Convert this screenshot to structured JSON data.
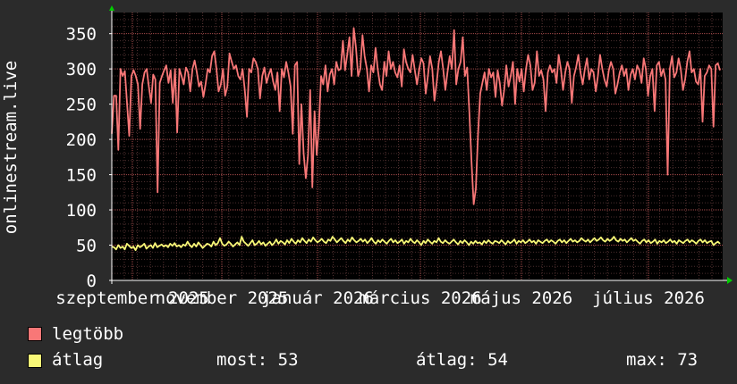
{
  "chart_data": {
    "type": "line",
    "ylabel": "onlinestream.live",
    "ylim": [
      0,
      380
    ],
    "yticks": [
      0,
      50,
      100,
      150,
      200,
      250,
      300,
      350
    ],
    "xtick_labels": [
      "szeptember 2025",
      "november 2025",
      "január 2026",
      "március 2026",
      "május 2026",
      "július 2026"
    ],
    "grid": true,
    "colors": {
      "max": "#f87777",
      "avg": "#f8f877",
      "grid": "#a34a4a",
      "axis": "#ffffff",
      "arrow": "#00cc00"
    },
    "series": [
      {
        "name": "legtöbb",
        "color": "#f87777",
        "values": [
          208,
          262,
          262,
          185,
          300,
          290,
          297,
          250,
          205,
          290,
          298,
          290,
          278,
          215,
          278,
          295,
          300,
          275,
          252,
          292,
          285,
          125,
          280,
          290,
          298,
          305,
          280,
          298,
          252,
          300,
          210,
          300,
          290,
          278,
          302,
          295,
          268,
          300,
          312,
          295,
          275,
          282,
          260,
          278,
          300,
          295,
          318,
          325,
          300,
          268,
          278,
          300,
          262,
          275,
          322,
          310,
          300,
          305,
          290,
          285,
          300,
          270,
          232,
          300,
          295,
          315,
          310,
          300,
          258,
          290,
          302,
          280,
          292,
          300,
          282,
          270,
          295,
          240,
          300,
          288,
          310,
          295,
          275,
          208,
          305,
          310,
          165,
          250,
          180,
          145,
          178,
          270,
          132,
          240,
          178,
          218,
          290,
          278,
          305,
          268,
          292,
          300,
          278,
          310,
          298,
          300,
          340,
          298,
          320,
          345,
          290,
          358,
          330,
          290,
          300,
          348,
          318,
          300,
          268,
          305,
          295,
          330,
          300,
          278,
          270,
          310,
          290,
          325,
          300,
          310,
          295,
          288,
          305,
          275,
          328,
          310,
          300,
          295,
          320,
          298,
          278,
          300,
          315,
          308,
          265,
          290,
          318,
          300,
          255,
          280,
          310,
          325,
          300,
          270,
          295,
          318,
          300,
          355,
          278,
          300,
          310,
          345,
          290,
          302,
          240,
          168,
          108,
          130,
          208,
          265,
          280,
          295,
          270,
          300,
          288,
          295,
          260,
          298,
          280,
          248,
          270,
          305,
          275,
          290,
          310,
          250,
          300,
          282,
          300,
          268,
          300,
          320,
          305,
          270,
          280,
          325,
          290,
          298,
          285,
          240,
          295,
          305,
          295,
          300,
          280,
          320,
          300,
          270,
          295,
          310,
          300,
          252,
          290,
          302,
          320,
          295,
          278,
          300,
          315,
          285,
          300,
          295,
          268,
          290,
          320,
          300,
          285,
          275,
          298,
          310,
          300,
          265,
          278,
          295,
          305,
          290,
          300,
          270,
          292,
          300,
          285,
          305,
          298,
          280,
          315,
          300,
          262,
          290,
          300,
          240,
          305,
          310,
          290,
          300,
          285,
          150,
          300,
          318,
          288,
          295,
          315,
          300,
          270,
          285,
          310,
          325,
          295,
          300,
          282,
          278,
          300,
          225,
          290,
          295,
          305,
          300,
          218,
          305,
          308,
          298
        ]
      },
      {
        "name": "átlag",
        "color": "#f8f877",
        "values": [
          48,
          47,
          44,
          50,
          46,
          48,
          44,
          52,
          49,
          46,
          48,
          43,
          50,
          47,
          49,
          52,
          45,
          48,
          50,
          46,
          53,
          47,
          49,
          51,
          48,
          50,
          47,
          52,
          49,
          53,
          48,
          50,
          47,
          51,
          49,
          55,
          50,
          47,
          52,
          48,
          54,
          50,
          46,
          49,
          52,
          51,
          48,
          55,
          50,
          53,
          60,
          52,
          49,
          51,
          55,
          52,
          48,
          51,
          54,
          50,
          62,
          55,
          52,
          49,
          53,
          57,
          50,
          52,
          56,
          51,
          54,
          49,
          52,
          55,
          50,
          53,
          58,
          52,
          56,
          54,
          51,
          57,
          53,
          59,
          55,
          52,
          57,
          54,
          60,
          56,
          53,
          58,
          55,
          61,
          57,
          54,
          56,
          59,
          55,
          53,
          58,
          56,
          62,
          58,
          54,
          57,
          60,
          56,
          53,
          58,
          55,
          61,
          57,
          54,
          56,
          59,
          55,
          58,
          53,
          56,
          60,
          55,
          52,
          57,
          54,
          58,
          55,
          52,
          56,
          59,
          54,
          57,
          53,
          55,
          58,
          52,
          56,
          54,
          59,
          55,
          53,
          57,
          54,
          50,
          56,
          53,
          58,
          55,
          52,
          56,
          54,
          60,
          55,
          53,
          57,
          54,
          52,
          55,
          58,
          54,
          51,
          56,
          53,
          57,
          54,
          50,
          55,
          52,
          56,
          53,
          54,
          51,
          56,
          53,
          57,
          54,
          52,
          56,
          55,
          53,
          57,
          54,
          51,
          56,
          53,
          55,
          58,
          52,
          56,
          54,
          57,
          53,
          55,
          58,
          54,
          56,
          52,
          57,
          55,
          53,
          56,
          58,
          54,
          57,
          55,
          52,
          56,
          58,
          54,
          57,
          53,
          56,
          59,
          55,
          57,
          54,
          56,
          60,
          57,
          55,
          58,
          54,
          57,
          60,
          56,
          58,
          61,
          57,
          55,
          59,
          56,
          58,
          62,
          57,
          55,
          59,
          56,
          58,
          54,
          57,
          60,
          56,
          58,
          55,
          52,
          56,
          58,
          54,
          57,
          53,
          55,
          58,
          52,
          56,
          54,
          57,
          53,
          55,
          58,
          54,
          56,
          52,
          57,
          55,
          53,
          56,
          58,
          54,
          57,
          55,
          52,
          56,
          58,
          54,
          57,
          53,
          55,
          56,
          50,
          53,
          55,
          52
        ]
      }
    ]
  },
  "legend": [
    {
      "label": "legtöbb",
      "color": "#f87777"
    },
    {
      "label": "átlag",
      "color": "#f8f877"
    }
  ],
  "stats": {
    "now": "most: 53",
    "avg": "átlag: 54",
    "max": "max: 73"
  }
}
